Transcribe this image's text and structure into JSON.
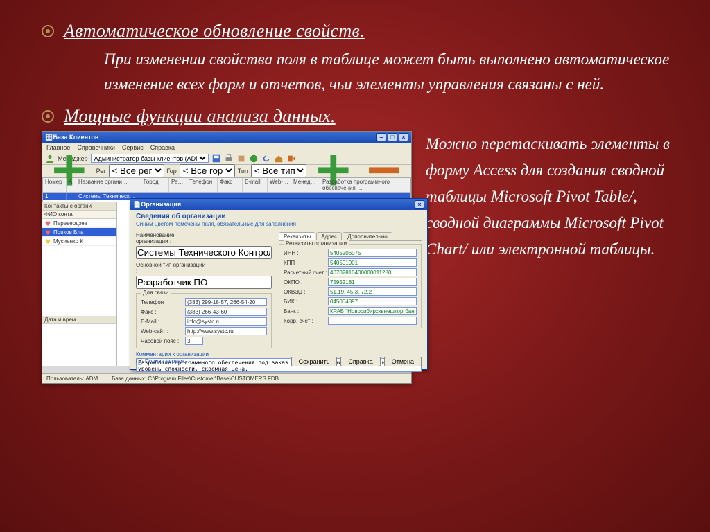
{
  "slide": {
    "h1a": "Автоматическое обновление свойств.",
    "body": "При изменении свойства поля в таблице может быть выполнено автоматическое изменение всех форм и отчетов, чьи элементы управления связаны с ней.",
    "h1b": "Мощные функции анализа данных.",
    "right": "Можно перетаскивать элементы в форму Access для создания сводной таблицы Microsoft Pivot Table/, сводной диаграммы Microsoft Pivot Chart/ или электронной таблицы."
  },
  "app": {
    "title": "База Клиентов",
    "menu": [
      "Главное",
      "Справочники",
      "Сервис",
      "Справка"
    ],
    "toolbar": {
      "manager_label": "Менеджер",
      "manager_value": "Администратор базы клиентов (ADM)"
    },
    "filters": {
      "reg_label": "Рег",
      "reg_value": "< Все регионы >",
      "gor_label": "Гор",
      "gor_value": "< Все города >",
      "tip_label": "Тип",
      "tip_value": "< Все типы >"
    },
    "grid_headers": [
      "Номер",
      "А",
      "Название органи…",
      "Город",
      "Ре…",
      "Телефон",
      "Факс",
      "E-mail",
      "Web-…",
      "Менед…",
      "Разработка программного обеспечения …"
    ],
    "grid_row": [
      "1",
      "",
      "Системы Техническ…",
      "",
      "",
      "",
      "",
      "",
      "",
      "",
      ""
    ],
    "left": {
      "section1": "Контакты с органи",
      "col_label": "ФИО конта",
      "rows": [
        "Перевердзев",
        "Попков Вла",
        "Мусиенко К"
      ],
      "section2": "Дата и врем"
    },
    "dialog": {
      "title": "Организация",
      "heading": "Сведения об организации",
      "hint": "Синим цветом помечены поля, обязательные для заполнения",
      "name_label": "Наименование организации :",
      "name_value": "Системы Технического Контроля, ООО",
      "type_label": "Основной тип организации :",
      "type_value": "Разработчик ПО",
      "contact_legend": "Для связи",
      "phone_label": "Телефон :",
      "phone_value": "(383) 299-18-57, 266-54-20",
      "fax_label": "Факс :",
      "fax_value": "(383) 266-43-60",
      "email_label": "E-Mail :",
      "email_value": "info@systc.ru",
      "web_label": "Web-сайт :",
      "web_value": "http://www.systc.ru",
      "tz_label": "Часовой пояс :",
      "tz_value": "3",
      "tabs": [
        "Реквизиты",
        "Адрес",
        "Дополнительно"
      ],
      "req_legend": "Реквизиты организации",
      "inn_label": "ИНН :",
      "inn_value": "5405206075",
      "kpp_label": "КПП :",
      "kpp_value": "540501001",
      "acc_label": "Расчетный счет :",
      "acc_value": "40702810400000011280",
      "okpo_label": "ОКПО :",
      "okpo_value": "75952181",
      "okved_label": "ОКВЭД :",
      "okved_value": "51.19, 45.3, 72.2",
      "bik_label": "БИК :",
      "bik_value": "045004897",
      "bank_label": "Банк :",
      "bank_value": "КРАБ \"Новосибирсквнешторгбанк\" (ЗАО)",
      "korr_label": "Корр. счет :",
      "korr_value": "",
      "comments_label": "Комментарии к организации",
      "comments_value": "Разработка программного обеспечения под заказ по|Вашему техническому заданию. Любой уровень сложности, скромная цена.",
      "full_link": "Полная версия…",
      "save_btn": "Сохранить",
      "help_btn": "Справка",
      "cancel_btn": "Отмена"
    },
    "statusbar": {
      "user_label": "Пользователь: ADM",
      "db_label": "База данных: C:\\Program Files\\Customer\\Base\\CUSTOMERS.FDB"
    }
  }
}
